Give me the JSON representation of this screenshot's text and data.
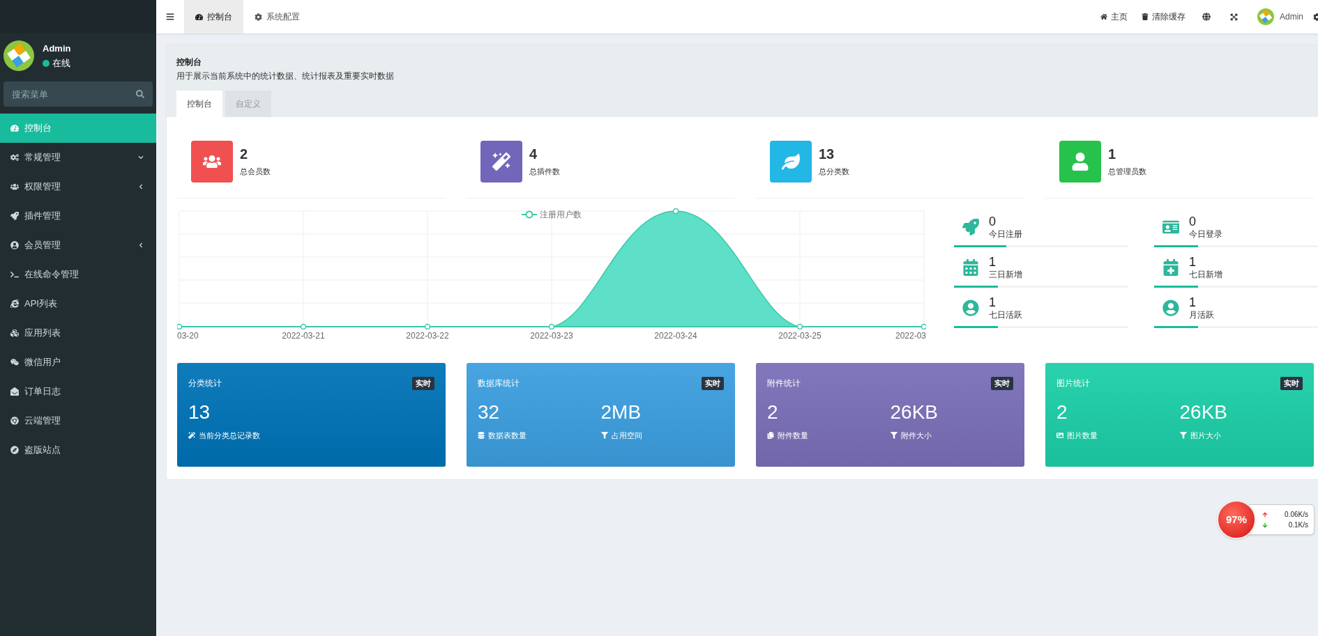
{
  "sidebar": {
    "user": {
      "name": "Admin",
      "status": "在线"
    },
    "search": {
      "placeholder": "搜索菜单"
    },
    "items": [
      {
        "label": "控制台",
        "kind": "link",
        "selected": true
      },
      {
        "label": "常规管理",
        "kind": "group",
        "expanded": true,
        "selected": false
      },
      {
        "label": "权限管理",
        "kind": "group",
        "expanded": false,
        "selected": false
      },
      {
        "label": "插件管理",
        "kind": "link",
        "selected": false
      },
      {
        "label": "会员管理",
        "kind": "group",
        "expanded": false,
        "selected": false
      },
      {
        "label": "在线命令管理",
        "kind": "link",
        "selected": false
      },
      {
        "label": "API列表",
        "kind": "link",
        "selected": false
      },
      {
        "label": "应用列表",
        "kind": "link",
        "selected": false
      },
      {
        "label": "微信用户",
        "kind": "link",
        "selected": false
      },
      {
        "label": "订单日志",
        "kind": "link",
        "selected": false
      },
      {
        "label": "云端管理",
        "kind": "link",
        "selected": false
      },
      {
        "label": "盗版站点",
        "kind": "link",
        "selected": false
      }
    ]
  },
  "topbar": {
    "tabs": [
      {
        "label": "控制台",
        "selected": true
      },
      {
        "label": "系统配置",
        "selected": false
      }
    ],
    "actions": [
      "主页",
      "清除缓存"
    ],
    "user": "Admin"
  },
  "panel": {
    "title": "控制台",
    "subtitle": "用于展示当前系统中的统计数据、统计报表及重要实时数据",
    "tabs": [
      {
        "label": "控制台",
        "selected": true
      },
      {
        "label": "自定义",
        "selected": false
      }
    ]
  },
  "stats": [
    {
      "value": "2",
      "label": "总会员数",
      "color": "#f05050"
    },
    {
      "value": "4",
      "label": "总插件数",
      "color": "#7266ba"
    },
    {
      "value": "13",
      "label": "总分类数",
      "color": "#23b7e5"
    },
    {
      "value": "1",
      "label": "总管理员数",
      "color": "#27c24c"
    }
  ],
  "chart": {
    "legend": "注册用户数",
    "x_labels": [
      "03-20",
      "2022-03-21",
      "2022-03-22",
      "2022-03-23",
      "2022-03-24",
      "2022-03-25",
      "2022-03"
    ]
  },
  "mini_stats": [
    {
      "value": "0",
      "label": "今日注册",
      "level": 0.3
    },
    {
      "value": "0",
      "label": "今日登录",
      "level": 0.25
    },
    {
      "value": "1",
      "label": "三日新增",
      "level": 0.25
    },
    {
      "value": "1",
      "label": "七日新增",
      "level": 0.25
    },
    {
      "value": "1",
      "label": "七日活跃",
      "level": 0.25
    },
    {
      "value": "1",
      "label": "月活跃",
      "level": 0.25
    }
  ],
  "cards": [
    {
      "title": "分类统计",
      "badge": "实时",
      "color": "#0073b7",
      "metrics": [
        {
          "value": "13",
          "label": "当前分类总记录数"
        }
      ]
    },
    {
      "title": "数据库统计",
      "badge": "实时",
      "color": "#3c9fe0",
      "metrics": [
        {
          "value": "32",
          "label": "数据表数量"
        },
        {
          "value": "2MB",
          "label": "占用空间"
        }
      ]
    },
    {
      "title": "附件统计",
      "badge": "实时",
      "color": "#7a6fb8",
      "metrics": [
        {
          "value": "2",
          "label": "附件数量"
        },
        {
          "value": "26KB",
          "label": "附件大小"
        }
      ]
    },
    {
      "title": "图片统计",
      "badge": "实时",
      "color": "#1ccfa8",
      "metrics": [
        {
          "value": "2",
          "label": "图片数量"
        },
        {
          "value": "26KB",
          "label": "图片大小"
        }
      ]
    }
  ],
  "speed_widget": {
    "percent": "97%",
    "upload": "0.06K/s",
    "download": "0.1K/s"
  }
}
